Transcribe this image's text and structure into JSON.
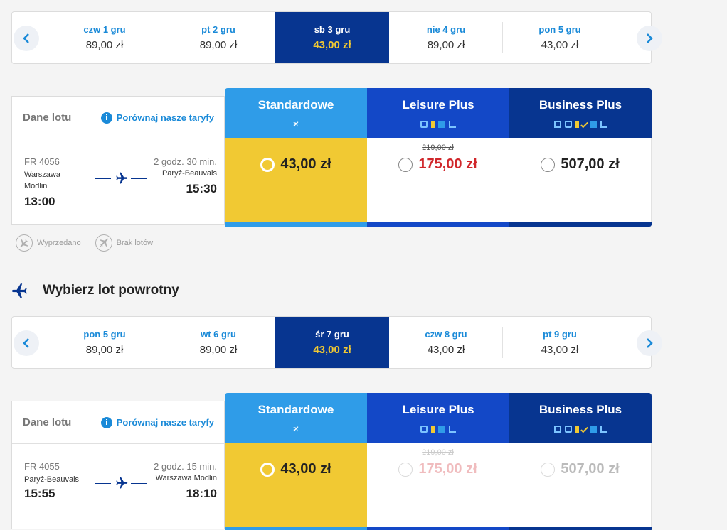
{
  "colors": {
    "accent": "#073590",
    "selected": "#f1c933",
    "link": "#1a8ad8",
    "standard": "#2f9ce8",
    "leisure": "#1348c7",
    "business": "#073590",
    "promo_price": "#d0262a"
  },
  "outbound": {
    "days": [
      {
        "name": "czw 1 gru",
        "price": "89,00 zł",
        "active": false
      },
      {
        "name": "pt 2 gru",
        "price": "89,00 zł",
        "active": false
      },
      {
        "name": "sb 3 gru",
        "price": "43,00 zł",
        "active": true
      },
      {
        "name": "nie 4 gru",
        "price": "89,00 zł",
        "active": false
      },
      {
        "name": "pon 5 gru",
        "price": "43,00 zł",
        "active": false
      }
    ],
    "info": {
      "label": "Dane lotu",
      "compare": "Porównaj nasze taryfy",
      "flight_number": "FR 4056",
      "duration": "2 godz. 30 min.",
      "from_line1": "Warszawa",
      "from_line2": "Modlin",
      "to": "Paryż-Beauvais",
      "dep_time": "13:00",
      "arr_time": "15:30"
    },
    "fares": {
      "standard": {
        "name": "Standardowe",
        "price": "43,00 zł"
      },
      "leisure": {
        "name": "Leisure Plus",
        "old_price": "219,00 zł",
        "price": "175,00 zł"
      },
      "business": {
        "name": "Business Plus",
        "price": "507,00 zł"
      }
    },
    "legend": {
      "sold_out": "Wyprzedano",
      "no_flights": "Brak lotów"
    }
  },
  "return_title": "Wybierz lot powrotny",
  "return": {
    "days": [
      {
        "name": "pon 5 gru",
        "price": "89,00 zł",
        "active": false
      },
      {
        "name": "wt 6 gru",
        "price": "89,00 zł",
        "active": false
      },
      {
        "name": "śr 7 gru",
        "price": "43,00 zł",
        "active": true
      },
      {
        "name": "czw 8 gru",
        "price": "43,00 zł",
        "active": false
      },
      {
        "name": "pt 9 gru",
        "price": "43,00 zł",
        "active": false
      }
    ],
    "info": {
      "label": "Dane lotu",
      "compare": "Porównaj nasze taryfy",
      "flight_number": "FR 4055",
      "duration": "2 godz. 15 min.",
      "from_line1": "Paryż-Beauvais",
      "to": "Warszawa Modlin",
      "dep_time": "15:55",
      "arr_time": "18:10"
    },
    "fares": {
      "standard": {
        "name": "Standardowe",
        "price": "43,00 zł"
      },
      "leisure": {
        "name": "Leisure Plus",
        "old_price": "219,00 zł",
        "price": "175,00 zł"
      },
      "business": {
        "name": "Business Plus",
        "price": "507,00 zł"
      }
    }
  }
}
